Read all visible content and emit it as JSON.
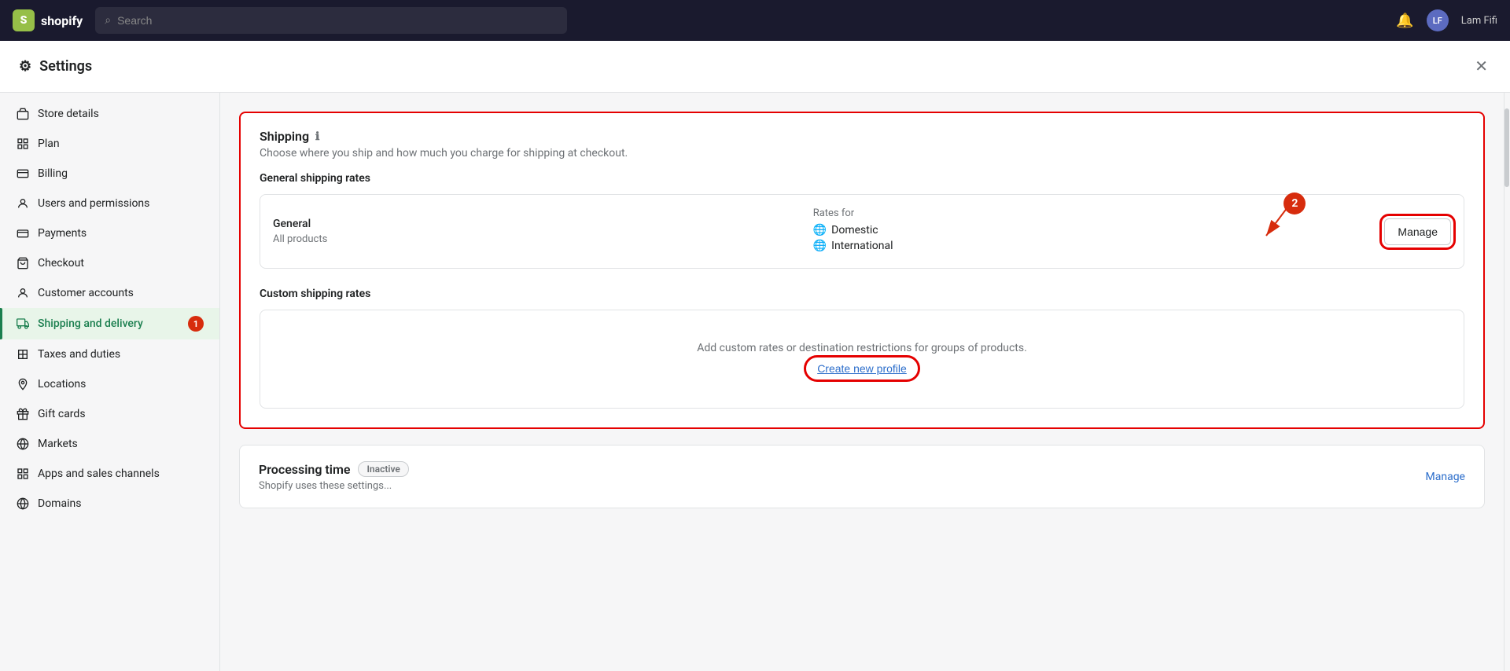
{
  "topnav": {
    "logo_text": "shopify",
    "search_placeholder": "Search",
    "notification_icon": "bell-icon",
    "user_initials": "LF",
    "user_name": "Lam Fifi"
  },
  "settings": {
    "title": "Settings",
    "close_label": "✕"
  },
  "sidebar": {
    "items": [
      {
        "id": "store-details",
        "label": "Store details",
        "icon": "store-icon"
      },
      {
        "id": "plan",
        "label": "Plan",
        "icon": "plan-icon"
      },
      {
        "id": "billing",
        "label": "Billing",
        "icon": "billing-icon"
      },
      {
        "id": "users",
        "label": "Users and permissions",
        "icon": "user-icon"
      },
      {
        "id": "payments",
        "label": "Payments",
        "icon": "payments-icon"
      },
      {
        "id": "checkout",
        "label": "Checkout",
        "icon": "checkout-icon"
      },
      {
        "id": "customer-accounts",
        "label": "Customer accounts",
        "icon": "customer-icon"
      },
      {
        "id": "shipping",
        "label": "Shipping and delivery",
        "icon": "shipping-icon",
        "active": true,
        "badge": "1"
      },
      {
        "id": "taxes",
        "label": "Taxes and duties",
        "icon": "taxes-icon"
      },
      {
        "id": "locations",
        "label": "Locations",
        "icon": "location-icon"
      },
      {
        "id": "gift-cards",
        "label": "Gift cards",
        "icon": "gift-icon"
      },
      {
        "id": "markets",
        "label": "Markets",
        "icon": "markets-icon"
      },
      {
        "id": "apps",
        "label": "Apps and sales channels",
        "icon": "apps-icon"
      },
      {
        "id": "domains",
        "label": "Domains",
        "icon": "domains-icon"
      }
    ]
  },
  "main": {
    "shipping_section_title": "Shipping",
    "shipping_card_title": "Shipping",
    "shipping_card_subtitle": "Choose where you ship and how much you charge for shipping at checkout.",
    "general_rates_label": "General shipping rates",
    "general_profile_name": "General",
    "general_profile_sub": "All products",
    "rates_for_label": "Rates for",
    "domestic_label": "Domestic",
    "international_label": "International",
    "manage_btn_label": "Manage",
    "custom_rates_label": "Custom shipping rates",
    "custom_empty_text": "Add custom rates or destination restrictions for groups of products.",
    "create_link_label": "Create new profile",
    "processing_time_title": "Processing time",
    "processing_time_badge": "Inactive",
    "processing_manage_label": "Manage",
    "processing_sub_text": "Shopify uses these settings...",
    "annotation_1": "1",
    "annotation_2": "2"
  }
}
